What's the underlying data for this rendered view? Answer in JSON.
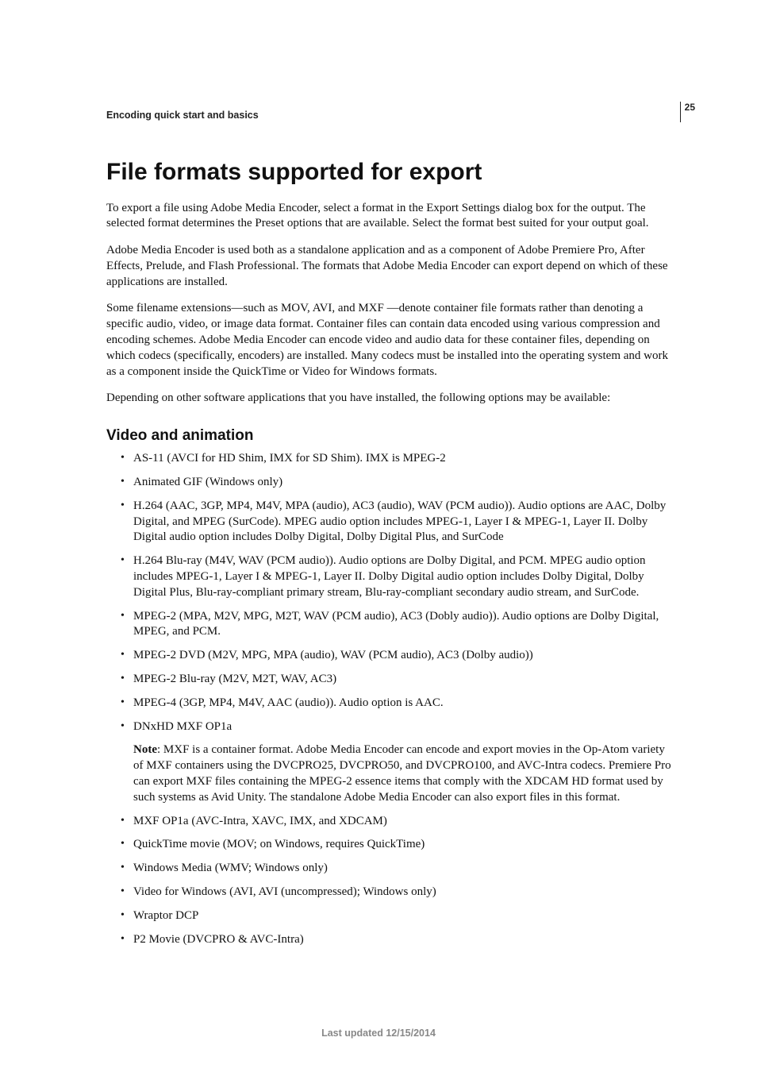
{
  "page_number": "25",
  "breadcrumb": "Encoding quick start and basics",
  "title": "File formats supported for export",
  "paragraphs": {
    "p1": "To export a file using Adobe Media Encoder, select a format in the Export Settings dialog box for the output. The selected format determines the Preset options that are available. Select the format best suited for your output goal.",
    "p2": "Adobe Media Encoder is used both as a standalone application and as a component of Adobe Premiere Pro, After Effects, Prelude, and Flash Professional. The formats that Adobe Media Encoder can export depend on which of these applications are installed.",
    "p3": "Some filename extensions—such as MOV, AVI, and MXF —denote container file formats rather than denoting a specific audio, video, or image data format. Container files can contain data encoded using various compression and encoding schemes. Adobe Media Encoder can encode video and audio data for these container files, depending on which codecs (specifically, encoders) are installed. Many codecs must be installed into the operating system and work as a component inside the QuickTime or Video for Windows formats.",
    "p4": "Depending on other software applications that you have installed, the following options may be available:"
  },
  "section_heading": "Video and animation",
  "items": [
    "AS-11 (AVCI for HD Shim, IMX for SD Shim). IMX is MPEG-2",
    "Animated GIF (Windows only)",
    "H.264 (AAC, 3GP, MP4, M4V, MPA (audio), AC3 (audio), WAV (PCM audio)). Audio options are AAC, Dolby Digital, and MPEG (SurCode). MPEG audio option includes MPEG-1, Layer I & MPEG-1, Layer II. Dolby Digital audio option includes Dolby Digital, Dolby Digital Plus, and SurCode",
    "H.264 Blu-ray (M4V, WAV (PCM audio)). Audio options are Dolby Digital, and PCM. MPEG audio option includes MPEG-1, Layer I & MPEG-1, Layer II. Dolby Digital audio option includes Dolby Digital, Dolby Digital Plus, Blu-ray-compliant primary stream, Blu-ray-compliant secondary audio stream, and SurCode.",
    "MPEG-2 (MPA, M2V, MPG, M2T, WAV (PCM audio), AC3 (Dobly audio)). Audio options are Dolby Digital, MPEG, and PCM.",
    "MPEG-2 DVD (M2V, MPG, MPA (audio), WAV (PCM audio), AC3 (Dolby audio))",
    "MPEG-2 Blu-ray (M2V, M2T, WAV, AC3)",
    "MPEG-4 (3GP, MP4, M4V, AAC (audio)). Audio option is AAC.",
    "DNxHD MXF OP1a",
    "MXF OP1a (AVC-Intra, XAVC, IMX, and XDCAM)",
    "QuickTime movie (MOV; on Windows, requires QuickTime)",
    "Windows Media (WMV; Windows only)",
    "Video for Windows (AVI, AVI (uncompressed); Windows only)",
    "Wraptor DCP",
    "P2 Movie (DVCPRO & AVC-Intra)"
  ],
  "note": {
    "label": "Note",
    "text": ": MXF is a container format. Adobe Media Encoder can encode and export movies in the Op-Atom variety of MXF containers using the DVCPRO25, DVCPRO50, and DVCPRO100, and AVC-Intra codecs. Premiere Pro can export MXF files containing the MPEG-2 essence items that comply with the XDCAM HD format used by such systems as Avid Unity. The standalone Adobe Media Encoder can also export files in this format."
  },
  "footer": "Last updated 12/15/2014"
}
